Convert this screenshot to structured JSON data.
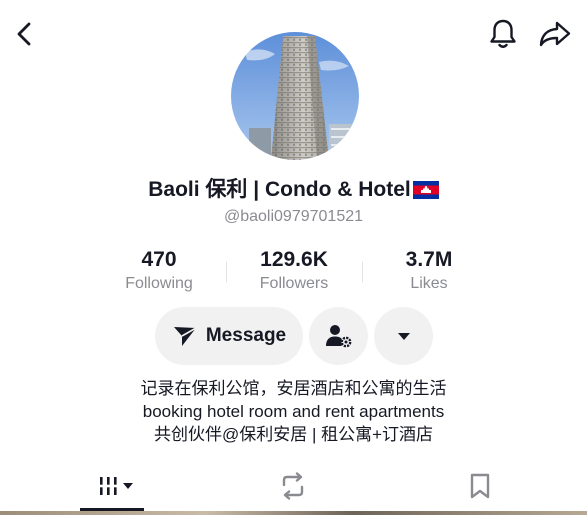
{
  "header": {
    "back_icon": "chevron-left-icon",
    "bell_icon": "bell-icon",
    "share_icon": "share-arrow-icon"
  },
  "profile": {
    "name": "Baoli 保利 | Condo & Hotel",
    "flag": "cambodia-flag",
    "handle": "@baoli0979701521"
  },
  "stats": [
    {
      "value": "470",
      "label": "Following"
    },
    {
      "value": "129.6K",
      "label": "Followers"
    },
    {
      "value": "3.7M",
      "label": "Likes"
    }
  ],
  "actions": {
    "message_label": "Message",
    "add_friend_icon": "person-gear-icon",
    "more_icon": "caret-down-icon"
  },
  "bio": [
    "记录在保利公馆，安居酒店和公寓的生活",
    "booking hotel room and rent apartments",
    "共创伙伴@保利安居 | 租公寓+订酒店"
  ],
  "tabs": [
    {
      "name": "videos",
      "icon": "grid-icon"
    },
    {
      "name": "reposts",
      "icon": "repost-icon"
    },
    {
      "name": "saved",
      "icon": "bookmark-icon"
    }
  ],
  "colors": {
    "text": "#161823",
    "secondary": "#8a8b91",
    "pill": "#f1f1f2"
  }
}
